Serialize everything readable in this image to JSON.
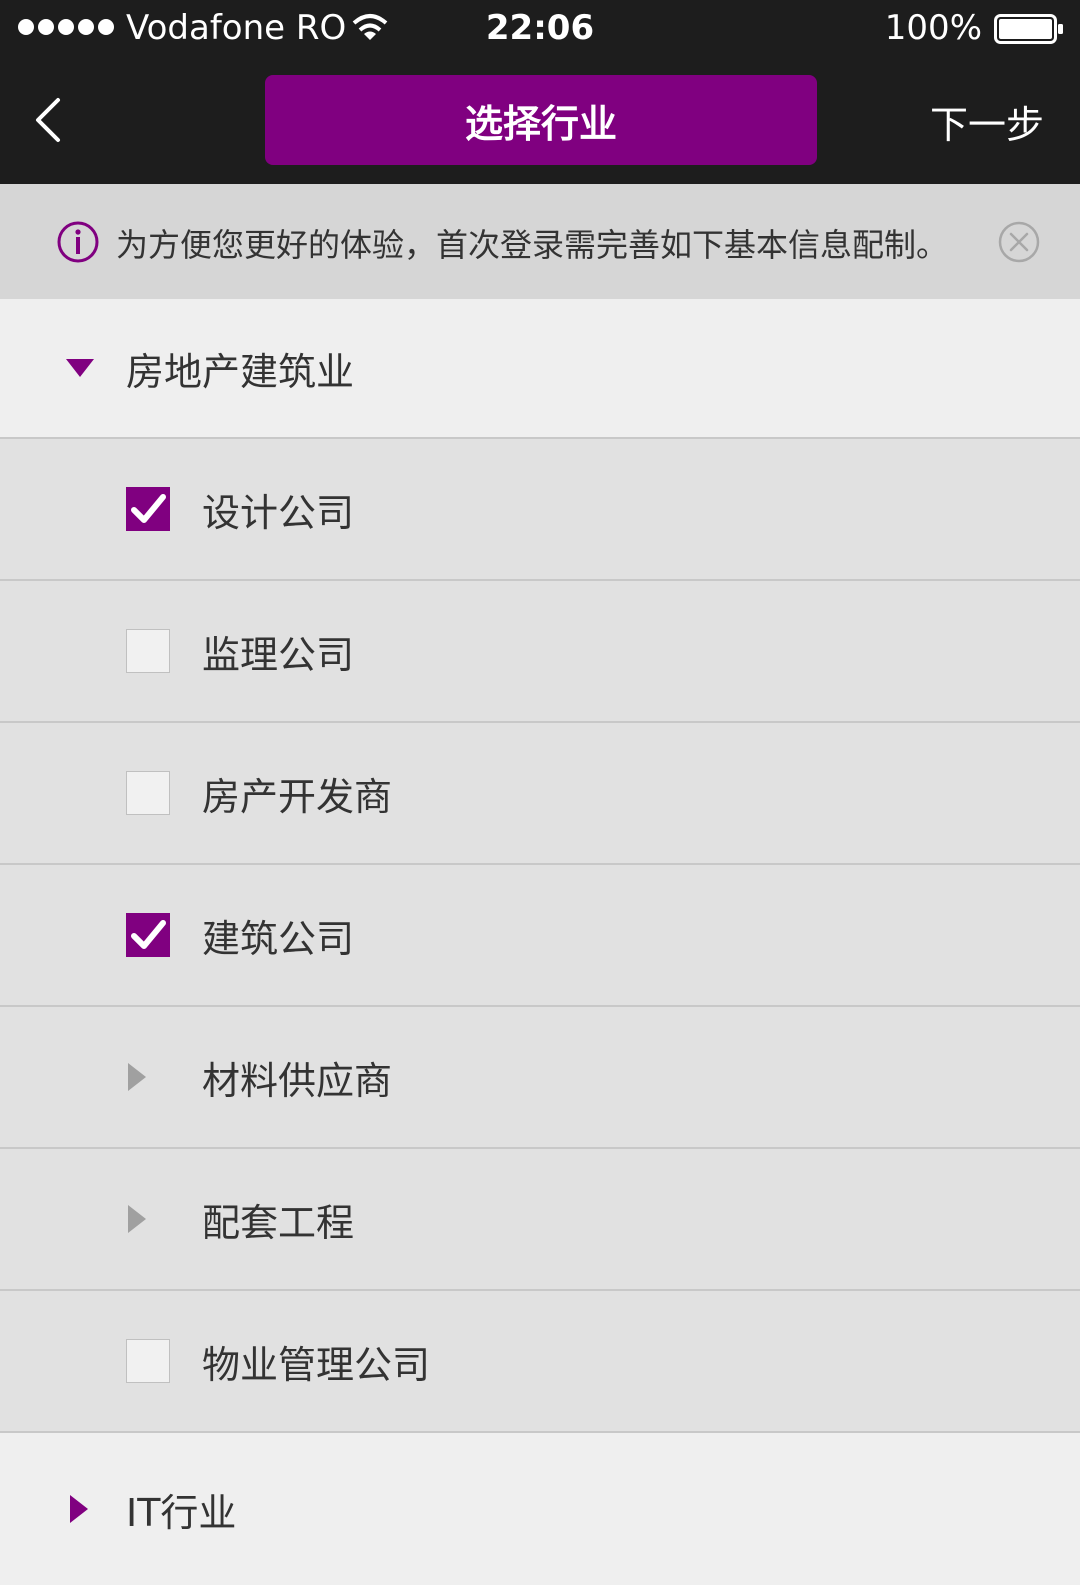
{
  "status_bar": {
    "carrier": "Vodafone RO",
    "time": "22:06",
    "battery": "100%"
  },
  "nav": {
    "title": "选择行业",
    "next_label": "下一步",
    "accent_color": "#800080"
  },
  "notice": {
    "message": "为方便您更好的体验，首次登录需完善如下基本信息配制。"
  },
  "list": {
    "category_1": "房地产建筑业",
    "items": [
      {
        "label": "设计公司",
        "control": "checkbox",
        "checked": true
      },
      {
        "label": "监理公司",
        "control": "checkbox",
        "checked": false
      },
      {
        "label": "房产开发商",
        "control": "checkbox",
        "checked": false
      },
      {
        "label": "建筑公司",
        "control": "checkbox",
        "checked": true
      },
      {
        "label": "材料供应商",
        "control": "expand-arrow"
      },
      {
        "label": "配套工程",
        "control": "expand-arrow"
      },
      {
        "label": "物业管理公司",
        "control": "checkbox",
        "checked": false
      }
    ],
    "category_2": "IT行业"
  }
}
